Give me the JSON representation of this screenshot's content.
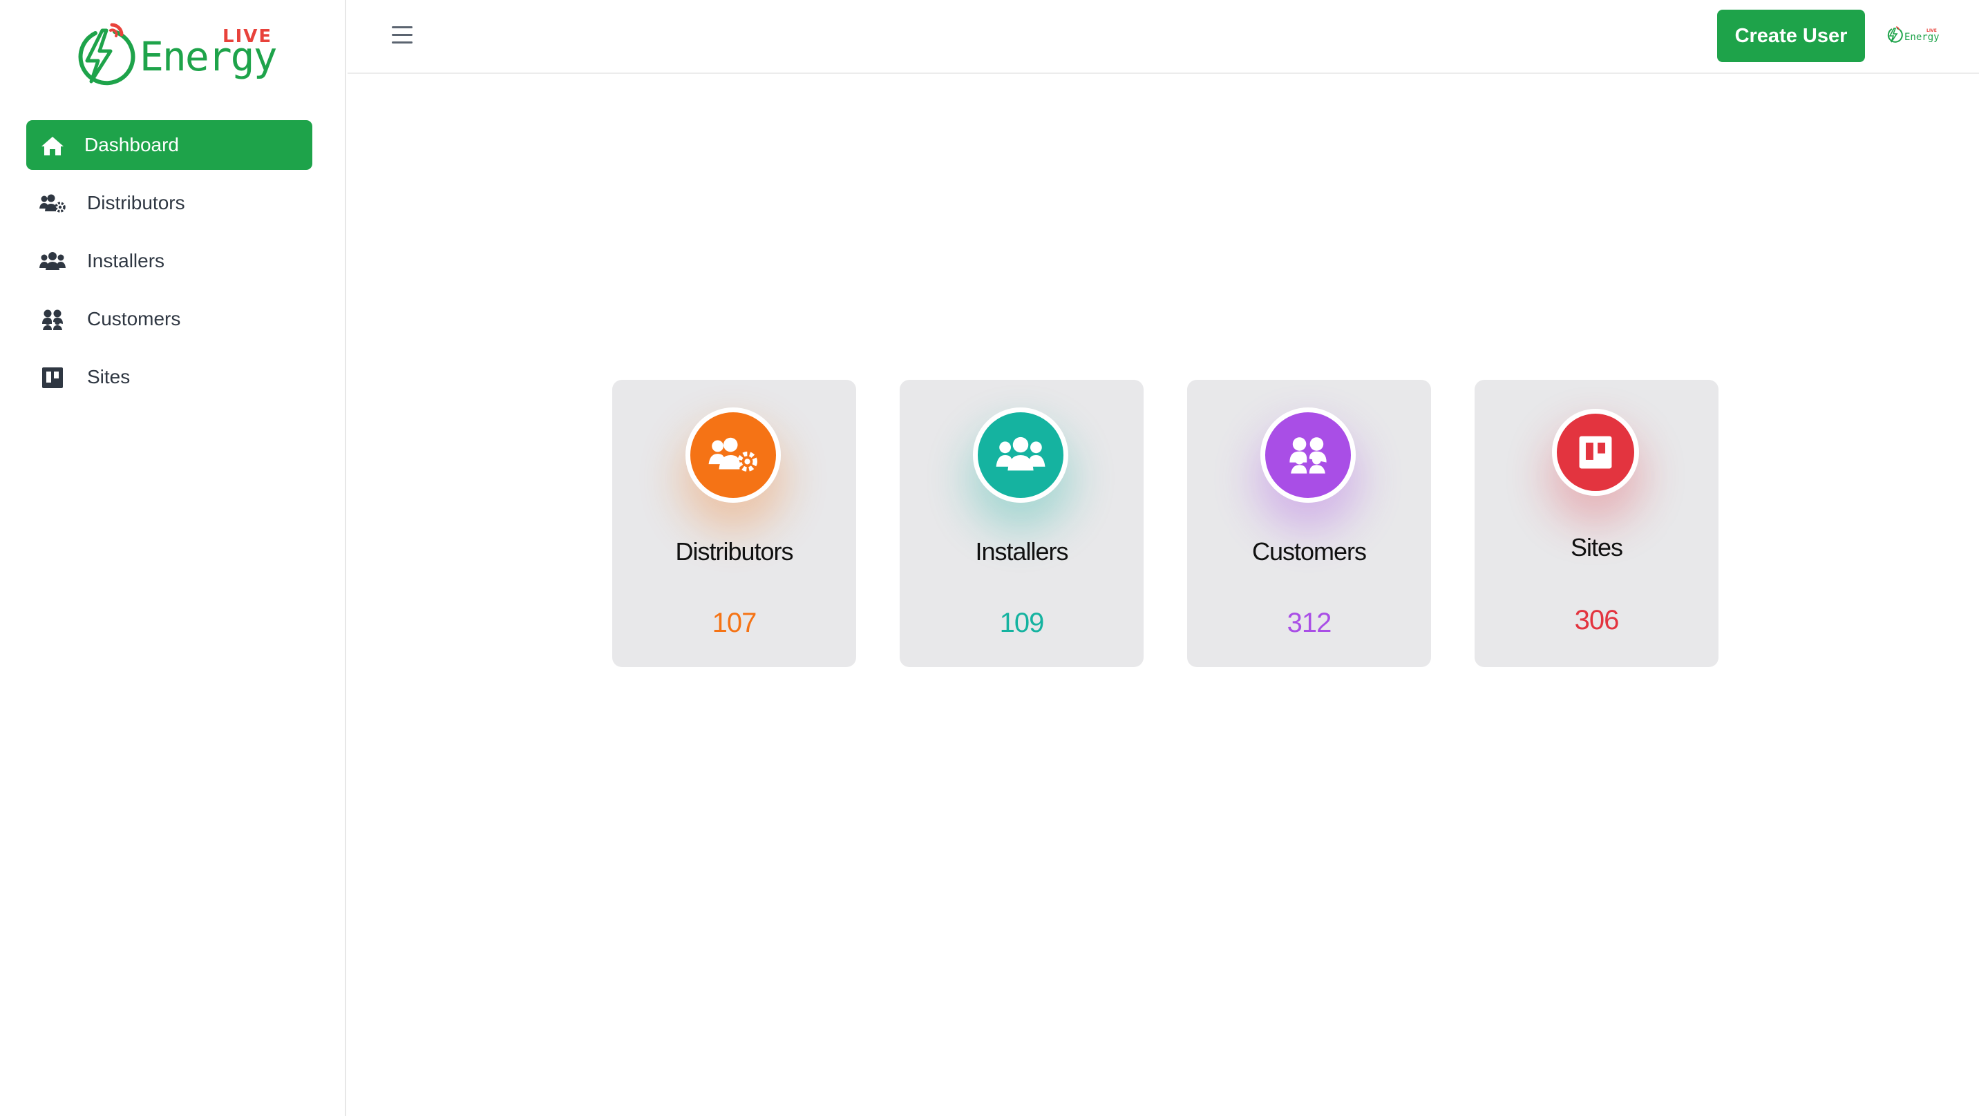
{
  "brand": {
    "name": "Energy",
    "tag": "LIVE",
    "green": "#1ea34a",
    "red": "#e8423b"
  },
  "sidebar": {
    "items": [
      {
        "label": "Dashboard",
        "icon": "home-icon",
        "active": true
      },
      {
        "label": "Distributors",
        "icon": "users-cog-icon",
        "active": false
      },
      {
        "label": "Installers",
        "icon": "users-icon",
        "active": false
      },
      {
        "label": "Customers",
        "icon": "user-friends-icon",
        "active": false
      },
      {
        "label": "Sites",
        "icon": "trello-icon",
        "active": false
      }
    ]
  },
  "header": {
    "menu_icon": "hamburger-icon",
    "create_label": "Create User"
  },
  "cards": [
    {
      "title": "Distributors",
      "value": "107",
      "color": "#f57315",
      "icon": "users-cog-icon"
    },
    {
      "title": "Installers",
      "value": "109",
      "color": "#15b3a0",
      "icon": "users-icon"
    },
    {
      "title": "Customers",
      "value": "312",
      "color": "#a94ee6",
      "icon": "user-friends-icon"
    },
    {
      "title": "Sites",
      "value": "306",
      "color": "#e3343f",
      "icon": "trello-icon"
    }
  ]
}
